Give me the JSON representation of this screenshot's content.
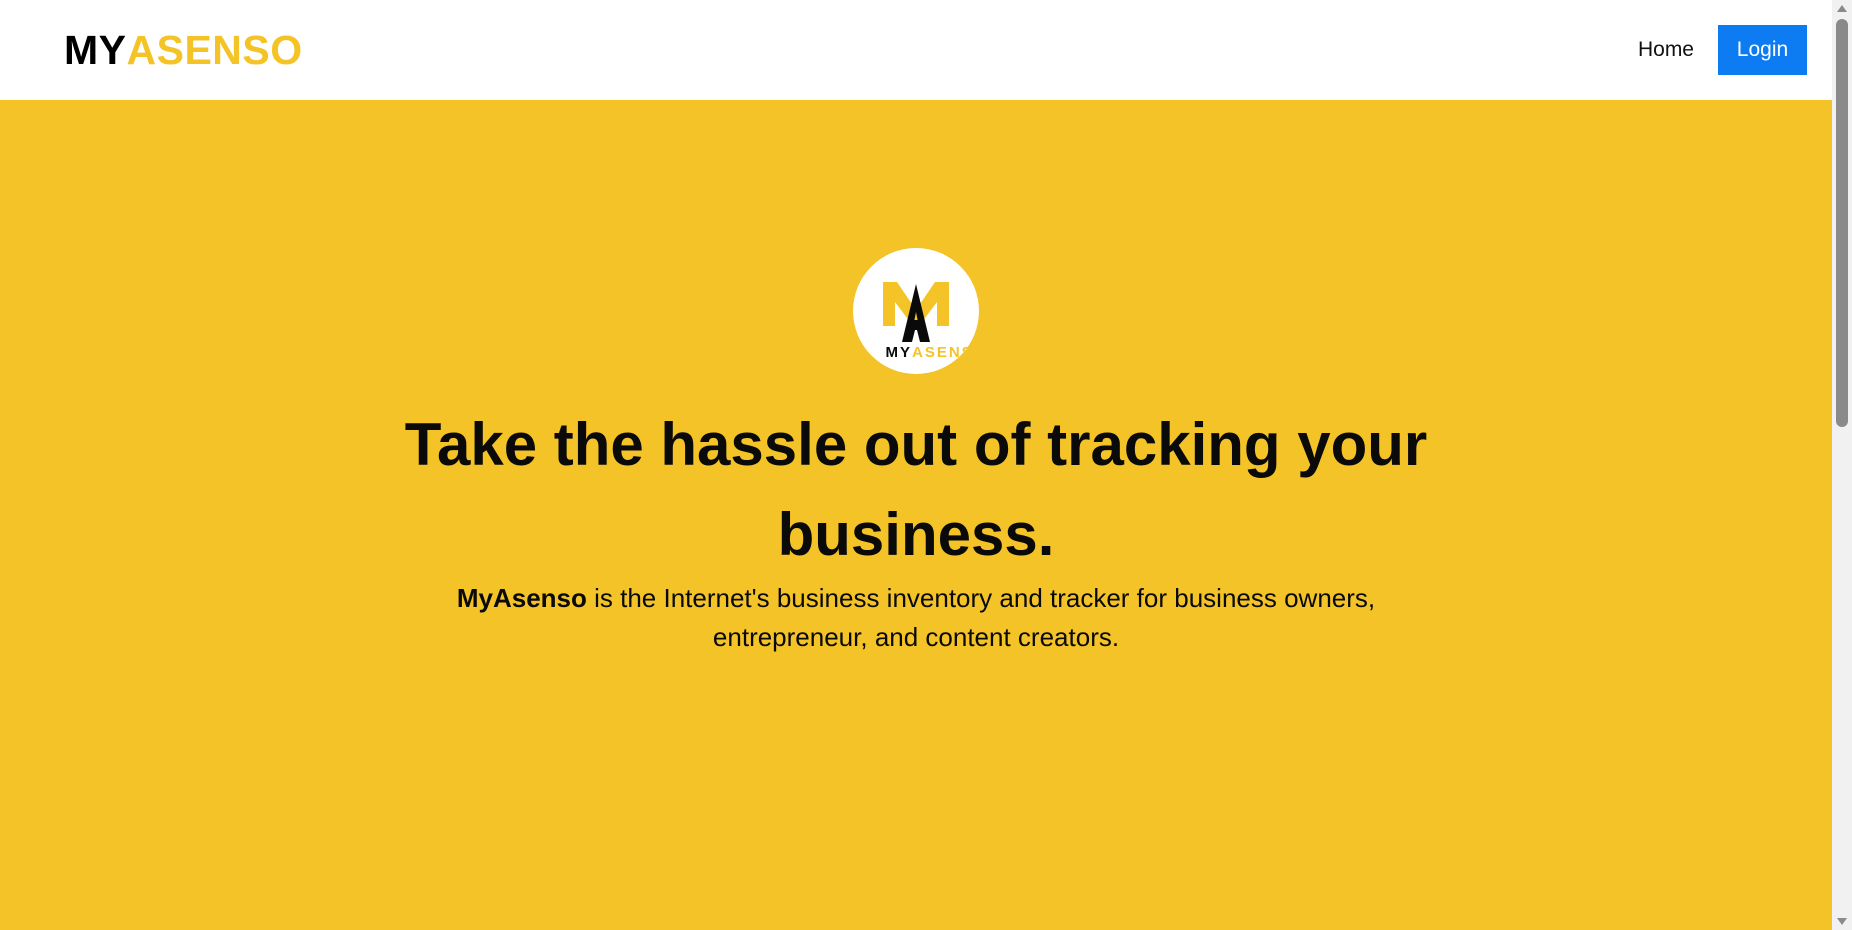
{
  "header": {
    "brand_my": "MY",
    "brand_asenso": "ASENSO",
    "nav": {
      "home_label": "Home",
      "login_label": "Login"
    }
  },
  "hero": {
    "logo": {
      "letter": "A",
      "text_my": "MY",
      "text_asenso": "ASENSO"
    },
    "title_line1": "Take the hassle out of tracking your",
    "title_line2": "business.",
    "subtitle_brand": "MyAsenso",
    "subtitle_rest1": " is the Internet's business inventory and tracker for business owners,",
    "subtitle_line2": "entrepreneur, and content creators."
  },
  "colors": {
    "brand_yellow": "#f4c327",
    "login_blue": "#0d7cf2",
    "text_dark": "#0a0a0a"
  },
  "icons": {
    "scroll_up": "triangle-up-icon",
    "scroll_down": "triangle-down-icon"
  }
}
